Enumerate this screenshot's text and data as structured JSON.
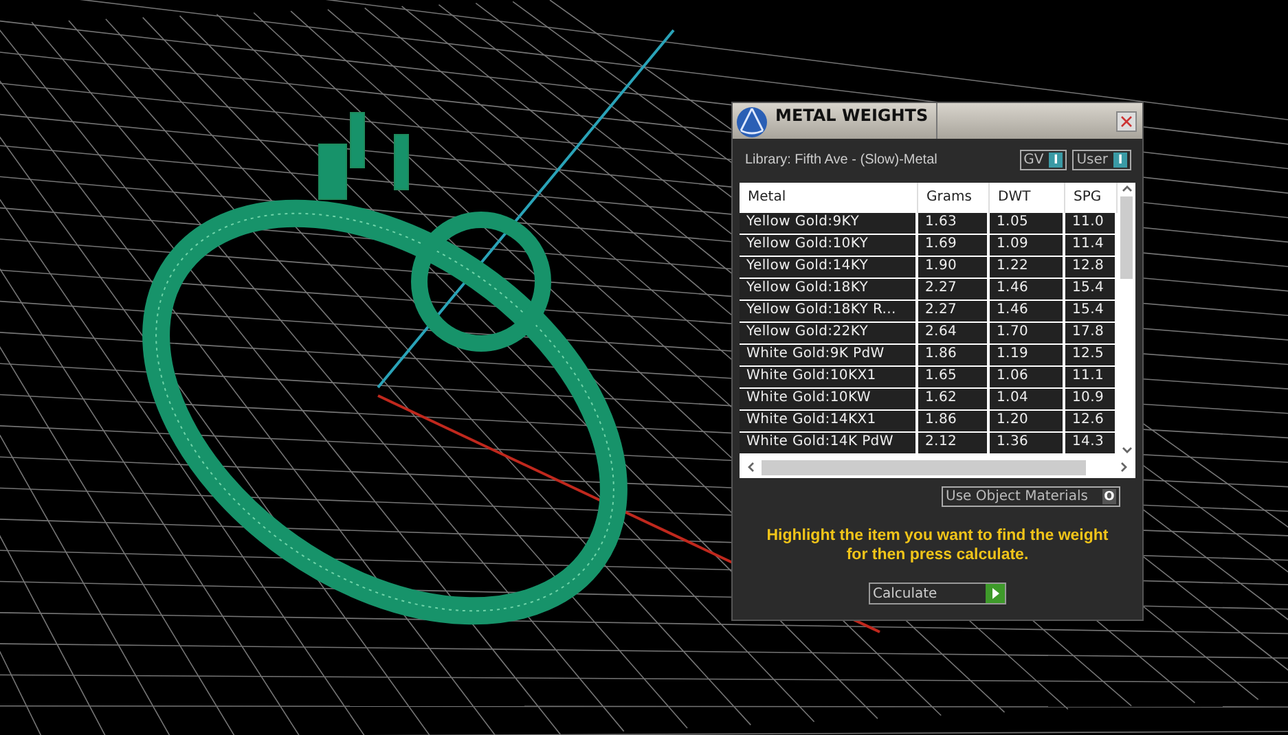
{
  "panel": {
    "title": "METAL WEIGHTS",
    "library": "Library: Fifth Ave - (Slow)-Metal",
    "toggles": [
      {
        "label": "GV",
        "on": true,
        "symbol": "I"
      },
      {
        "label": "User",
        "on": true,
        "symbol": "I"
      }
    ],
    "table": {
      "columns": [
        "Metal",
        "Grams",
        "DWT",
        "SPG"
      ],
      "rows": [
        [
          "Yellow Gold:9KY",
          "1.63",
          "1.05",
          "11.0"
        ],
        [
          "Yellow Gold:10KY",
          "1.69",
          "1.09",
          "11.4"
        ],
        [
          "Yellow Gold:14KY",
          "1.90",
          "1.22",
          "12.8"
        ],
        [
          "Yellow Gold:18KY",
          "2.27",
          "1.46",
          "15.4"
        ],
        [
          "Yellow Gold:18KY R...",
          "2.27",
          "1.46",
          "15.4"
        ],
        [
          "Yellow Gold:22KY",
          "2.64",
          "1.70",
          "17.8"
        ],
        [
          "White Gold:9K PdW",
          "1.86",
          "1.19",
          "12.5"
        ],
        [
          "White Gold:10KX1",
          "1.65",
          "1.06",
          "11.1"
        ],
        [
          "White Gold:10KW",
          "1.62",
          "1.04",
          "10.9"
        ],
        [
          "White Gold:14KX1",
          "1.86",
          "1.20",
          "12.6"
        ],
        [
          "White Gold:14K PdW",
          "2.12",
          "1.36",
          "14.3"
        ]
      ]
    },
    "object_materials": {
      "label": "Use Object Materials",
      "on": false,
      "symbol": "O"
    },
    "hint": "Highlight the item you want to find the weight for then press calculate.",
    "calculate": "Calculate"
  }
}
